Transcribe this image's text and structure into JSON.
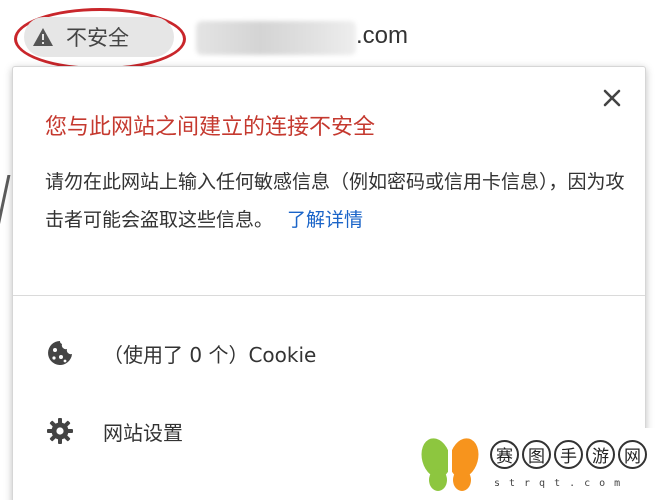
{
  "address_bar": {
    "security_label": "不安全",
    "url_domain_suffix": ".com",
    "url_obscured": true
  },
  "popup": {
    "title": "您与此网站之间建立的连接不安全",
    "description": "请勿在此网站上输入任何敏感信息（例如密码或信用卡信息），因为攻击者可能会盗取这些信息。",
    "learn_more": "了解详情",
    "cookie_label": "（使用了 0 个）Cookie",
    "site_settings_label": "网站设置"
  },
  "watermark": {
    "chars": [
      "赛",
      "图",
      "手",
      "游",
      "网"
    ],
    "sub": "strqt.com"
  },
  "colors": {
    "title_red": "#c5392f",
    "link_blue": "#1a64c8",
    "highlight_ring": "#c9262b",
    "chip_bg": "#e6e6e6"
  },
  "icons": {
    "security": "warning-triangle-icon",
    "close": "close-icon",
    "cookie": "cookie-icon",
    "settings": "gear-icon"
  }
}
